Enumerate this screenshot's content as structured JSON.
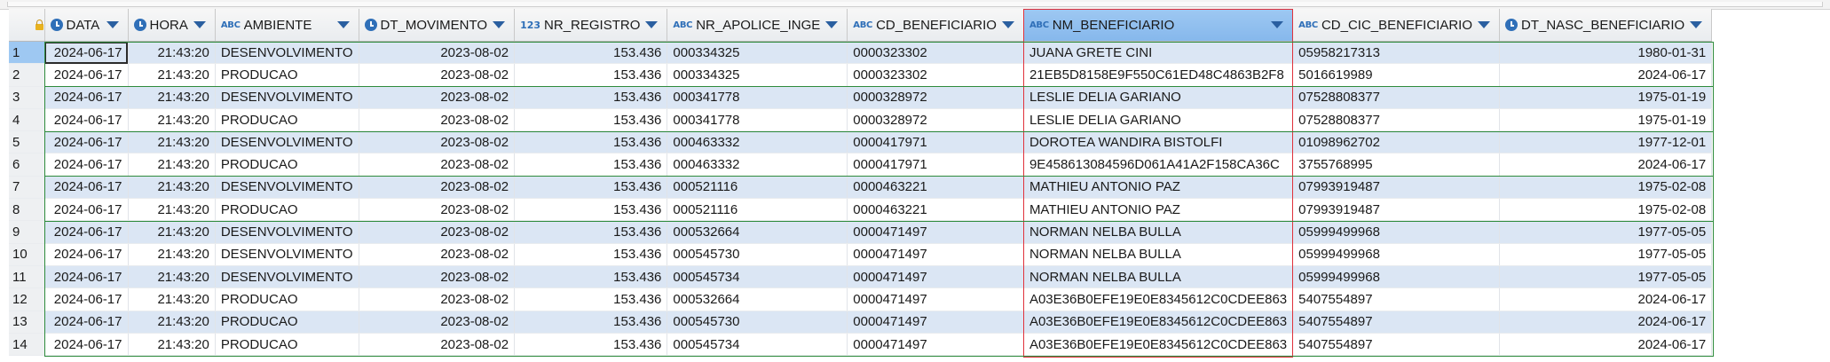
{
  "grid": {
    "columns": [
      {
        "key": "data",
        "label": "DATA",
        "type_icon": "clock-icon",
        "align": "right",
        "width": 94
      },
      {
        "key": "hora",
        "label": "HORA",
        "type_icon": "clock-icon",
        "align": "right",
        "width": 98
      },
      {
        "key": "ambiente",
        "label": "AMBIENTE",
        "type_icon": "abc-icon",
        "align": "left",
        "width": 122
      },
      {
        "key": "dt_movimento",
        "label": "DT_MOVIMENTO",
        "type_icon": "clock-icon",
        "align": "right",
        "width": 142
      },
      {
        "key": "nr_registro",
        "label": "NR_REGISTRO",
        "type_icon": "123-icon",
        "align": "right",
        "width": 126
      },
      {
        "key": "nr_apolice",
        "label": "NR_APOLICE_INGE",
        "type_icon": "abc-icon",
        "align": "left",
        "width": 150
      },
      {
        "key": "cd_beneficiario",
        "label": "CD_BENEFICIARIO",
        "type_icon": "abc-icon",
        "align": "left",
        "width": 150
      },
      {
        "key": "nm_beneficiario",
        "label": "NM_BENEFICIARIO",
        "type_icon": "abc-icon",
        "align": "left",
        "width": 248
      },
      {
        "key": "cd_cic",
        "label": "CD_CIC_BENEFICIARIO",
        "type_icon": "abc-icon",
        "align": "left",
        "width": 186
      },
      {
        "key": "dt_nasc",
        "label": "DT_NASC_BENEFICIARIO",
        "type_icon": "clock-icon",
        "align": "right",
        "width": 196
      }
    ],
    "rows": [
      {
        "n": "1",
        "data": "2024-06-17",
        "hora": "21:43:20",
        "ambiente": "DESENVOLVIMENTO",
        "dt_movimento": "2023-08-02",
        "nr_registro": "153.436",
        "nr_apolice": "000334325",
        "cd_beneficiario": "0000323302",
        "nm_beneficiario": "JUANA GRETE CINI",
        "cd_cic": "05958217313",
        "dt_nasc": "1980-01-31"
      },
      {
        "n": "2",
        "data": "2024-06-17",
        "hora": "21:43:20",
        "ambiente": "PRODUCAO",
        "dt_movimento": "2023-08-02",
        "nr_registro": "153.436",
        "nr_apolice": "000334325",
        "cd_beneficiario": "0000323302",
        "nm_beneficiario": "21EB5D8158E9F550C61ED48C4863B2F8",
        "cd_cic": "5016619989",
        "dt_nasc": "2024-06-17"
      },
      {
        "n": "3",
        "data": "2024-06-17",
        "hora": "21:43:20",
        "ambiente": "DESENVOLVIMENTO",
        "dt_movimento": "2023-08-02",
        "nr_registro": "153.436",
        "nr_apolice": "000341778",
        "cd_beneficiario": "0000328972",
        "nm_beneficiario": "LESLIE DELIA GARIANO",
        "cd_cic": "07528808377",
        "dt_nasc": "1975-01-19"
      },
      {
        "n": "4",
        "data": "2024-06-17",
        "hora": "21:43:20",
        "ambiente": "PRODUCAO",
        "dt_movimento": "2023-08-02",
        "nr_registro": "153.436",
        "nr_apolice": "000341778",
        "cd_beneficiario": "0000328972",
        "nm_beneficiario": "LESLIE DELIA GARIANO",
        "cd_cic": "07528808377",
        "dt_nasc": "1975-01-19"
      },
      {
        "n": "5",
        "data": "2024-06-17",
        "hora": "21:43:20",
        "ambiente": "DESENVOLVIMENTO",
        "dt_movimento": "2023-08-02",
        "nr_registro": "153.436",
        "nr_apolice": "000463332",
        "cd_beneficiario": "0000417971",
        "nm_beneficiario": "DOROTEA WANDIRA BISTOLFI",
        "cd_cic": "01098962702",
        "dt_nasc": "1977-12-01"
      },
      {
        "n": "6",
        "data": "2024-06-17",
        "hora": "21:43:20",
        "ambiente": "PRODUCAO",
        "dt_movimento": "2023-08-02",
        "nr_registro": "153.436",
        "nr_apolice": "000463332",
        "cd_beneficiario": "0000417971",
        "nm_beneficiario": "9E458613084596D061A41A2F158CA36C",
        "cd_cic": "3755768995",
        "dt_nasc": "2024-06-17"
      },
      {
        "n": "7",
        "data": "2024-06-17",
        "hora": "21:43:20",
        "ambiente": "DESENVOLVIMENTO",
        "dt_movimento": "2023-08-02",
        "nr_registro": "153.436",
        "nr_apolice": "000521116",
        "cd_beneficiario": "0000463221",
        "nm_beneficiario": "MATHIEU ANTONIO PAZ",
        "cd_cic": "07993919487",
        "dt_nasc": "1975-02-08"
      },
      {
        "n": "8",
        "data": "2024-06-17",
        "hora": "21:43:20",
        "ambiente": "PRODUCAO",
        "dt_movimento": "2023-08-02",
        "nr_registro": "153.436",
        "nr_apolice": "000521116",
        "cd_beneficiario": "0000463221",
        "nm_beneficiario": "MATHIEU ANTONIO PAZ",
        "cd_cic": "07993919487",
        "dt_nasc": "1975-02-08"
      },
      {
        "n": "9",
        "data": "2024-06-17",
        "hora": "21:43:20",
        "ambiente": "DESENVOLVIMENTO",
        "dt_movimento": "2023-08-02",
        "nr_registro": "153.436",
        "nr_apolice": "000532664",
        "cd_beneficiario": "0000471497",
        "nm_beneficiario": "NORMAN NELBA BULLA",
        "cd_cic": "05999499968",
        "dt_nasc": "1977-05-05"
      },
      {
        "n": "10",
        "data": "2024-06-17",
        "hora": "21:43:20",
        "ambiente": "DESENVOLVIMENTO",
        "dt_movimento": "2023-08-02",
        "nr_registro": "153.436",
        "nr_apolice": "000545730",
        "cd_beneficiario": "0000471497",
        "nm_beneficiario": "NORMAN NELBA BULLA",
        "cd_cic": "05999499968",
        "dt_nasc": "1977-05-05"
      },
      {
        "n": "11",
        "data": "2024-06-17",
        "hora": "21:43:20",
        "ambiente": "DESENVOLVIMENTO",
        "dt_movimento": "2023-08-02",
        "nr_registro": "153.436",
        "nr_apolice": "000545734",
        "cd_beneficiario": "0000471497",
        "nm_beneficiario": "NORMAN NELBA BULLA",
        "cd_cic": "05999499968",
        "dt_nasc": "1977-05-05"
      },
      {
        "n": "12",
        "data": "2024-06-17",
        "hora": "21:43:20",
        "ambiente": "PRODUCAO",
        "dt_movimento": "2023-08-02",
        "nr_registro": "153.436",
        "nr_apolice": "000532664",
        "cd_beneficiario": "0000471497",
        "nm_beneficiario": "A03E36B0EFE19E0E8345612C0CDEE863",
        "cd_cic": "5407554897",
        "dt_nasc": "2024-06-17"
      },
      {
        "n": "13",
        "data": "2024-06-17",
        "hora": "21:43:20",
        "ambiente": "PRODUCAO",
        "dt_movimento": "2023-08-02",
        "nr_registro": "153.436",
        "nr_apolice": "000545730",
        "cd_beneficiario": "0000471497",
        "nm_beneficiario": "A03E36B0EFE19E0E8345612C0CDEE863",
        "cd_cic": "5407554897",
        "dt_nasc": "2024-06-17"
      },
      {
        "n": "14",
        "data": "2024-06-17",
        "hora": "21:43:20",
        "ambiente": "PRODUCAO",
        "dt_movimento": "2023-08-02",
        "nr_registro": "153.436",
        "nr_apolice": "000545734",
        "cd_beneficiario": "0000471497",
        "nm_beneficiario": "A03E36B0EFE19E0E8345612C0CDEE863",
        "cd_cic": "5407554897",
        "dt_nasc": "2024-06-17"
      }
    ],
    "selected_column": "nm_beneficiario",
    "focused_row": "1",
    "colors": {
      "selection_outline": "#e0323c",
      "group_outline": "#2e8b3c",
      "alt_row": "#dbe6f4",
      "header_selected": "#9ec8f2",
      "type_icon": "#2f6fb8"
    }
  }
}
